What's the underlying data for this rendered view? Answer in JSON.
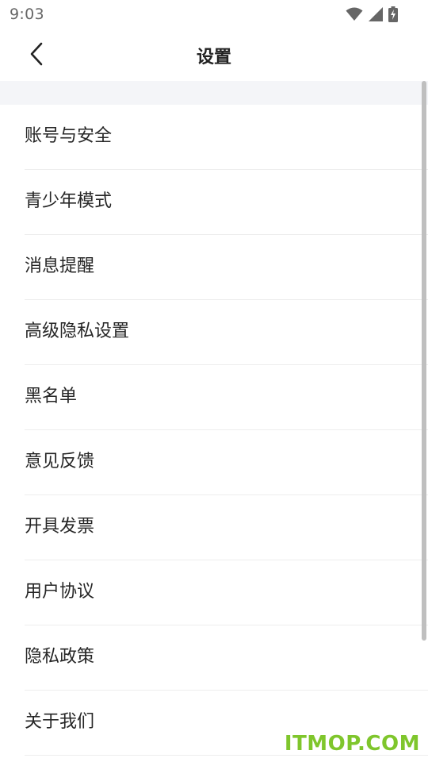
{
  "status_bar": {
    "time": "9:03",
    "icons": [
      "wifi-icon",
      "cellular-signal-icon",
      "battery-charging-icon"
    ]
  },
  "header": {
    "back_icon": "chevron-left-icon",
    "title": "设置"
  },
  "menu": {
    "items": [
      {
        "label": "账号与安全"
      },
      {
        "label": "青少年模式"
      },
      {
        "label": "消息提醒"
      },
      {
        "label": "高级隐私设置"
      },
      {
        "label": "黑名单"
      },
      {
        "label": "意见反馈"
      },
      {
        "label": "开具发票"
      },
      {
        "label": "用户协议"
      },
      {
        "label": "隐私政策"
      },
      {
        "label": "关于我们"
      }
    ]
  },
  "watermark": "ITMOP.COM",
  "colors": {
    "spacer_background": "#f4f5f8",
    "divider": "#ededed",
    "watermark": "#7fc62c",
    "text": "#262626"
  }
}
